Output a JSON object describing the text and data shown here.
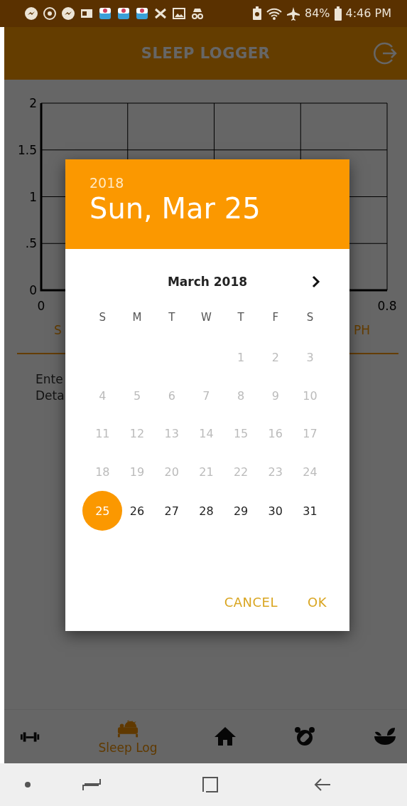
{
  "status_bar": {
    "battery": "84%",
    "time": "4:46 PM"
  },
  "app_bar": {
    "title": "SLEEP LOGGER"
  },
  "chart": {
    "chart_data": {
      "type": "line",
      "grid": true,
      "xlim": [
        0,
        0.8
      ],
      "ylim": [
        0,
        2
      ],
      "xticks": [
        0,
        0.8
      ],
      "yticks": [
        0,
        {
          "value": 0.5,
          "label": ".5"
        },
        1,
        {
          "value": 1.5,
          "label": "1.5"
        },
        2
      ]
    }
  },
  "graph_tabs": [
    {
      "label": "S"
    },
    {
      "label": "PH"
    }
  ],
  "entry_text": [
    "Ente",
    "Deta"
  ],
  "dialog": {
    "year": "2018",
    "date": "Sun, Mar 25",
    "month": "March 2018",
    "weekdays": [
      "S",
      "M",
      "T",
      "W",
      "T",
      "F",
      "S"
    ],
    "weeks": [
      [
        {
          "label": "1",
          "disabled": true,
          "selected": false
        },
        {
          "label": "2",
          "disabled": true,
          "selected": false
        },
        {
          "label": "3",
          "disabled": true,
          "selected": false
        }
      ],
      [
        {
          "label": "4",
          "disabled": true,
          "selected": false
        },
        {
          "label": "5",
          "disabled": true,
          "selected": false
        },
        {
          "label": "6",
          "disabled": true,
          "selected": false
        },
        {
          "label": "7",
          "disabled": true,
          "selected": false
        },
        {
          "label": "8",
          "disabled": true,
          "selected": false
        },
        {
          "label": "9",
          "disabled": true,
          "selected": false
        },
        {
          "label": "10",
          "disabled": true,
          "selected": false
        }
      ],
      [
        {
          "label": "11",
          "disabled": true,
          "selected": false
        },
        {
          "label": "12",
          "disabled": true,
          "selected": false
        },
        {
          "label": "13",
          "disabled": true,
          "selected": false
        },
        {
          "label": "14",
          "disabled": true,
          "selected": false
        },
        {
          "label": "15",
          "disabled": true,
          "selected": false
        },
        {
          "label": "16",
          "disabled": true,
          "selected": false
        },
        {
          "label": "17",
          "disabled": true,
          "selected": false
        }
      ],
      [
        {
          "label": "18",
          "disabled": true,
          "selected": false
        },
        {
          "label": "19",
          "disabled": true,
          "selected": false
        },
        {
          "label": "20",
          "disabled": true,
          "selected": false
        },
        {
          "label": "21",
          "disabled": true,
          "selected": false
        },
        {
          "label": "22",
          "disabled": true,
          "selected": false
        },
        {
          "label": "23",
          "disabled": true,
          "selected": false
        },
        {
          "label": "24",
          "disabled": true,
          "selected": false
        }
      ],
      [
        {
          "label": "25",
          "disabled": false,
          "selected": true
        },
        {
          "label": "26",
          "disabled": false,
          "selected": false
        },
        {
          "label": "27",
          "disabled": false,
          "selected": false
        },
        {
          "label": "28",
          "disabled": false,
          "selected": false
        },
        {
          "label": "29",
          "disabled": false,
          "selected": false
        },
        {
          "label": "30",
          "disabled": false,
          "selected": false
        },
        {
          "label": "31",
          "disabled": false,
          "selected": false
        }
      ]
    ],
    "buttons": [
      {
        "label": "CANCEL"
      },
      {
        "label": "OK"
      }
    ]
  },
  "nav_items": [
    {
      "kind": "dumbbell",
      "selected": false
    },
    {
      "kind": "bed",
      "label": "Sleep Log",
      "selected": true
    },
    {
      "kind": "home",
      "selected": false
    },
    {
      "kind": "alarm",
      "selected": false
    },
    {
      "kind": "bowl",
      "selected": false
    }
  ]
}
